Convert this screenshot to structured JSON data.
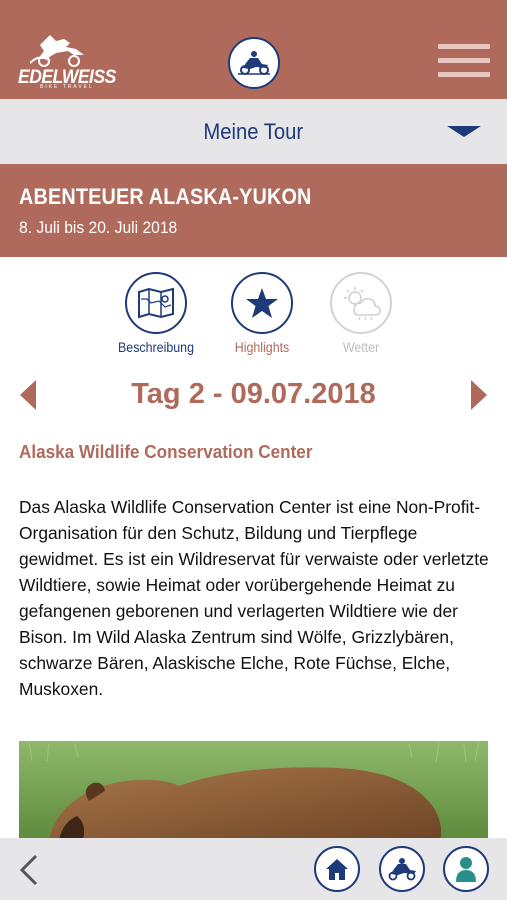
{
  "header": {
    "logo_text": "EDELWEISS",
    "logo_subtext": "BIKE TRAVEL",
    "menu_icon": "hamburger-menu-icon",
    "center_icon": "motorcycle-rider-icon"
  },
  "tour_selector": {
    "label": "Meine Tour",
    "icon": "chevron-down-icon"
  },
  "tour": {
    "title": "ABENTEUER ALASKA-YUKON",
    "dates": "8. Juli bis 20. Juli 2018"
  },
  "tabs": [
    {
      "label": "Beschreibung",
      "icon": "map-icon",
      "active": false
    },
    {
      "label": "Highlights",
      "icon": "star-icon",
      "active": true
    },
    {
      "label": "Wetter",
      "icon": "weather-icon",
      "disabled": true
    }
  ],
  "day": {
    "title": "Tag 2 - 09.07.2018"
  },
  "highlight": {
    "name": "Alaska Wildlife Conservation Center",
    "description": "Das Alaska Wildlife Conservation Center ist eine Non-Profit-Organisation für den Schutz, Bildung und Tierpflege gewidmet. Es ist ein Wildreservat für verwaiste oder verletzte Wildtiere, sowie Heimat oder vorübergehende Heimat zu gefangenen geborenen und verlagerten Wildtiere wie der Bison. Im Wild Alaska Zentrum sind Wölfe, Grizzlybären, schwarze Bären, Alaskische Elche, Rote Füchse, Elche, Muskoxen."
  },
  "bottom_nav": {
    "back_icon": "back-chevron-icon",
    "items": [
      "home-icon",
      "motorcycle-rider-icon",
      "user-icon"
    ]
  },
  "colors": {
    "brand_red": "#b06a5c",
    "brand_blue": "#1f3a78",
    "bar_grey": "#e6e6e9"
  }
}
